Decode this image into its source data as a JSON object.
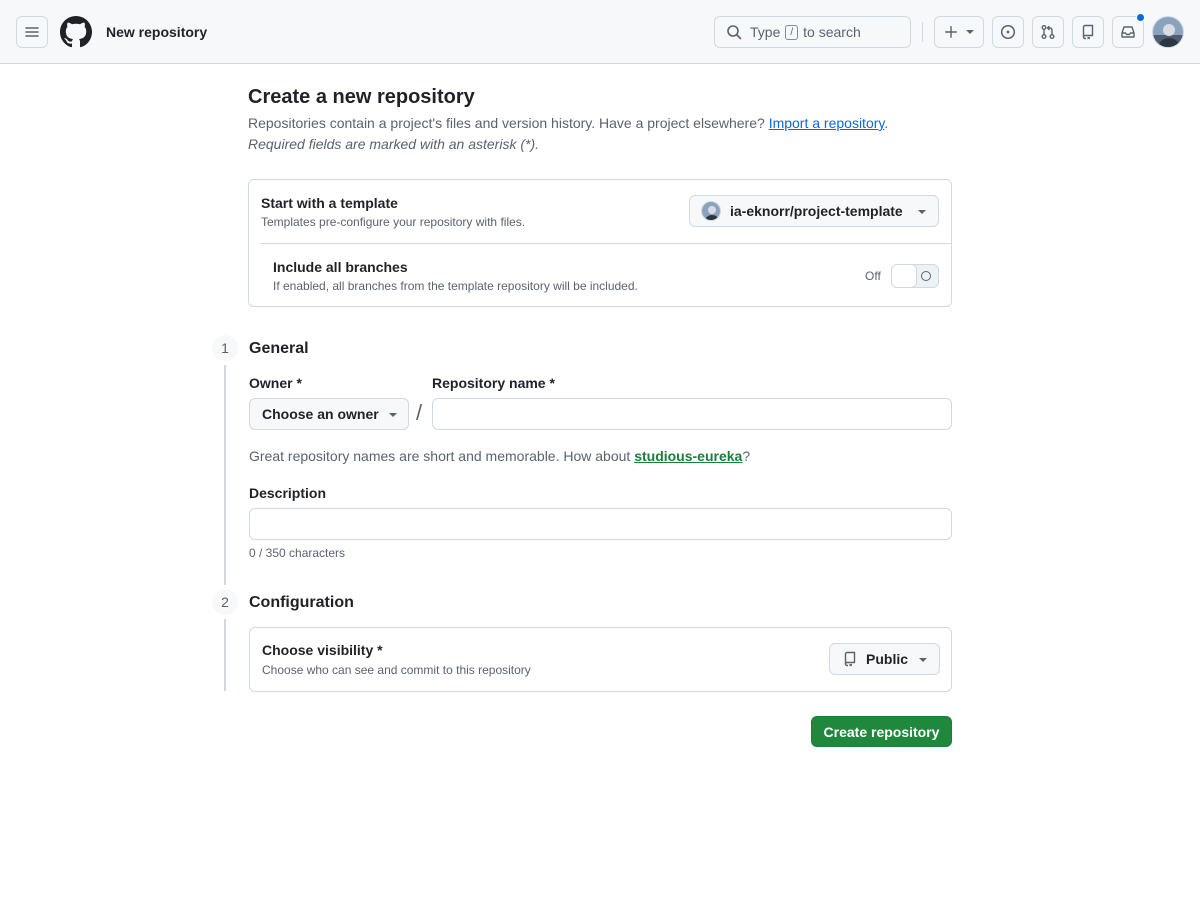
{
  "header": {
    "page_context": "New repository",
    "search": {
      "prefix": "Type",
      "key": "/",
      "suffix": "to search"
    }
  },
  "main": {
    "title": "Create a new repository",
    "subtitle_text": "Repositories contain a project's files and version history. Have a project elsewhere? ",
    "import_link": "Import a repository",
    "subtitle_end": ".",
    "required_note": "Required fields are marked with an asterisk (*)."
  },
  "template": {
    "title": "Start with a template",
    "description": "Templates pre-configure your repository with files.",
    "selected": "ia-eknorr/project-template",
    "branches_title": "Include all branches",
    "branches_description": "If enabled, all branches from the template repository will be included.",
    "toggle_state": "Off"
  },
  "general": {
    "step": "1",
    "title": "General",
    "owner_label": "Owner *",
    "owner_select": "Choose an owner",
    "slash": "/",
    "repo_name_label": "Repository name *",
    "repo_name_value": "",
    "suggestion_text": "Great repository names are short and memorable. How about ",
    "suggestion_name": "studious-eureka",
    "suggestion_end": "?",
    "description_label": "Description",
    "description_value": "",
    "char_count": "0 / 350 characters"
  },
  "configuration": {
    "step": "2",
    "title": "Configuration",
    "visibility_label": "Choose visibility *",
    "visibility_description": "Choose who can see and commit to this repository",
    "visibility_value": "Public"
  },
  "actions": {
    "create_label": "Create repository"
  },
  "colors": {
    "primary": "#1f883d",
    "link": "#0969da",
    "border": "#d1d9e0",
    "header_bg": "#f6f8fa",
    "notification": "#0969da"
  }
}
